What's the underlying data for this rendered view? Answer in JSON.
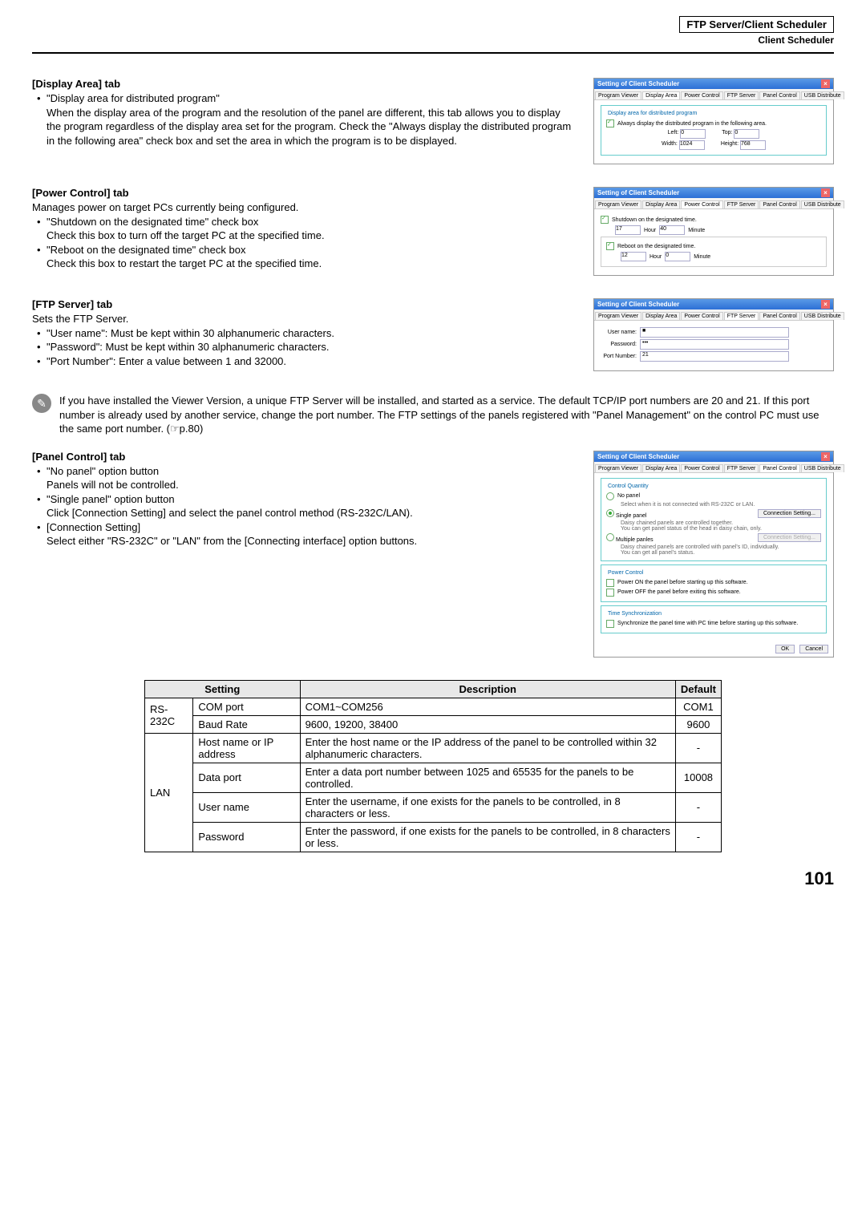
{
  "header": {
    "title": "FTP Server/Client Scheduler",
    "sub": "Client Scheduler"
  },
  "display_area": {
    "title": "[Display Area] tab",
    "b1": "\"Display area for distributed program\"",
    "p1": "When the display area of the program and the resolution of the panel are different, this tab allows you to display the program regardless of the display area set for the program. Check the \"Always display the distributed program in the following area\" check box and set the area in which the program is to be displayed."
  },
  "power_control": {
    "title": "[Power Control] tab",
    "intro": "Manages power on target PCs currently being configured.",
    "b1": "\"Shutdown on the designated time\" check box",
    "p1": "Check this box to turn off the target PC at the specified time.",
    "b2": "\"Reboot on the designated time\" check box",
    "p2": "Check this box to restart the target PC at the specified time."
  },
  "ftp_server": {
    "title": "[FTP Server] tab",
    "intro": "Sets the FTP Server.",
    "b1": "\"User name\": Must be kept within 30 alphanumeric characters.",
    "b2": "\"Password\": Must be kept within 30 alphanumeric characters.",
    "b3": "\"Port Number\": Enter a value between 1 and 32000."
  },
  "note": "If you have installed the Viewer Version, a unique FTP Server will be installed, and started as a service. The default TCP/IP port numbers are 20 and 21. If this port number is already used by another service, change the port number. The FTP settings of the panels registered with \"Panel Management\" on the control PC must use the same port number. (☞p.80)",
  "panel_control": {
    "title": "[Panel Control] tab",
    "b1": "\"No panel\" option button",
    "p1": "Panels will not be controlled.",
    "b2": "\"Single panel\" option button",
    "p2": "Click [Connection Setting] and select the panel control method (RS-232C/LAN).",
    "b3": "[Connection Setting]",
    "p3": "Select either \"RS-232C\" or \"LAN\" from the [Connecting interface] option buttons."
  },
  "dlg": {
    "title": "Setting of Client Scheduler",
    "tabs": [
      "Program Viewer",
      "Display Area",
      "Power Control",
      "FTP Server",
      "Panel Control",
      "USB Distribute"
    ],
    "display": {
      "group": "Display area for distributed program",
      "cb": "Always display the distributed program in the following area.",
      "left": "Left:",
      "left_v": "0",
      "top": "Top:",
      "top_v": "0",
      "width": "Width:",
      "width_v": "1024",
      "height": "Height:",
      "height_v": "768"
    },
    "power": {
      "cb1": "Shutdown on the designated time.",
      "h1": "17",
      "m1": "40",
      "hour": "Hour",
      "minute": "Minute",
      "cb2": "Reboot on the designated time.",
      "h2": "12",
      "m2": "0"
    },
    "ftp": {
      "user": "User name:",
      "user_v": "■",
      "pass": "Password:",
      "pass_v": "•••",
      "port": "Port Number:",
      "port_v": "21"
    },
    "panel": {
      "cq": "Control Quantity",
      "no": "No panel",
      "no_desc": "Select when it is not connected with RS-232C or LAN.",
      "single": "Single panel",
      "single_desc": "Daisy chained panels are controlled together.\nYou can get panel status of the head in daisy chain, only.",
      "multi": "Multiple panles",
      "multi_desc": "Daisy chained panels are controlled with panel's ID, individually.\nYou can get all panel's status.",
      "conn": "Connection Setting...",
      "pc": "Power Control",
      "pon": "Power ON the panel before starting up this software.",
      "poff": "Power OFF the panel before exiting this software.",
      "ts": "Time Synchronization",
      "sync": "Synchronize the panel time with PC time before starting up this software.",
      "ok": "OK",
      "cancel": "Cancel"
    }
  },
  "table": {
    "h1": "Setting",
    "h2": "Description",
    "h3": "Default",
    "rs": "RS-232C",
    "lan": "LAN",
    "r1s": "COM port",
    "r1d": "COM1~COM256",
    "r1v": "COM1",
    "r2s": "Baud Rate",
    "r2d": "9600, 19200, 38400",
    "r2v": "9600",
    "r3s": "Host name or IP address",
    "r3d": "Enter the host name or the IP address of the panel to be controlled within 32 alphanumeric characters.",
    "r3v": "-",
    "r4s": "Data port",
    "r4d": "Enter a data port number between 1025 and 65535 for the panels to be controlled.",
    "r4v": "10008",
    "r5s": "User name",
    "r5d": "Enter the username, if one exists for the panels to be controlled, in 8 characters or less.",
    "r5v": "-",
    "r6s": "Password",
    "r6d": "Enter the password, if one exists for the panels to be controlled, in 8 characters or less.",
    "r6v": "-"
  },
  "page": "101"
}
